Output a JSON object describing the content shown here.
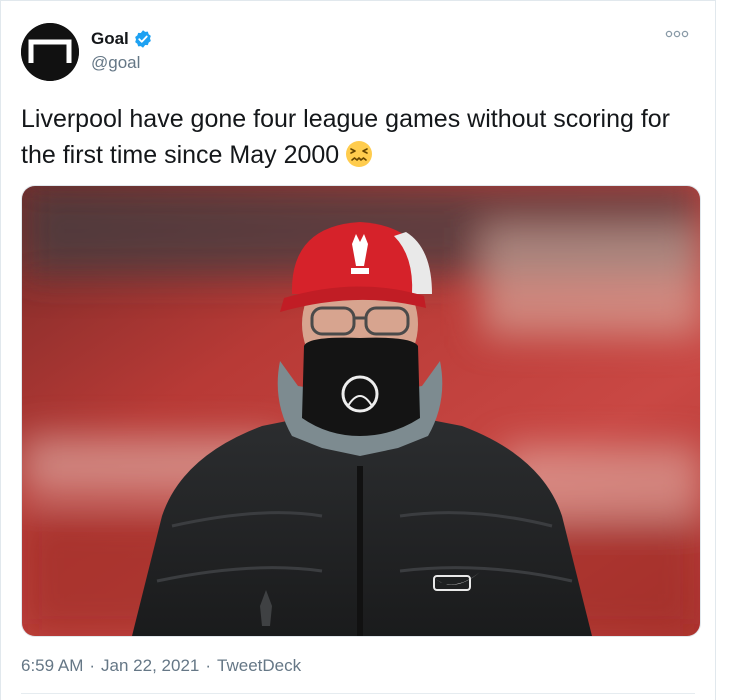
{
  "account": {
    "display_name": "Goal",
    "handle": "@goal",
    "verified": true,
    "avatar_icon": "goal-logo-icon"
  },
  "menu": {
    "icon": "more-options-icon"
  },
  "tweet": {
    "text": "Liverpool have gone four league games without scoring for the first time since May 2000",
    "emoji_icon": "confounded-face-emoji"
  },
  "media": {
    "kind": "photo"
  },
  "meta": {
    "time": "6:59 AM",
    "date": "Jan 22, 2021",
    "source": "TweetDeck",
    "separator": "·"
  },
  "colors": {
    "verified_blue": "#1da1f2",
    "text_primary": "#14171a",
    "text_secondary": "#657786",
    "border": "#e1e8ed"
  }
}
